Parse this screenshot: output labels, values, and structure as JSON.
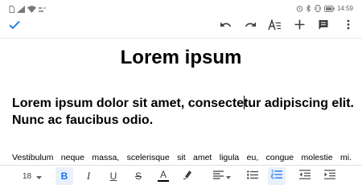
{
  "status_bar": {
    "time": "14:59",
    "left_icons": [
      "sim-icon",
      "signal-icon",
      "wifi-icon",
      "data-speed-icon"
    ],
    "right_icons": [
      "alarm-icon",
      "bluetooth-icon",
      "vibrate-icon",
      "battery-icon"
    ]
  },
  "toolbar": {
    "icons": [
      "check-icon",
      "undo-icon",
      "redo-icon",
      "text-format-icon",
      "add-icon",
      "comment-icon",
      "more-vert-icon"
    ],
    "accent_color": "#1a73e8"
  },
  "document": {
    "title": "Lorem ipsum",
    "heading_before_cursor": "Lorem ipsum dolor sit amet, consecte",
    "heading_after_cursor": "tur adipiscing elit. Nunc ac faucibus odio.",
    "body_line": "Vestibulum neque massa, scelerisque sit amet ligula eu, congue molestie mi."
  },
  "format_bar": {
    "font_size": "18",
    "bold": "B",
    "italic": "I",
    "underline": "U",
    "strikethrough": "S",
    "text_color": "A",
    "text_color_value": "#000000",
    "active_color": "#1a73e8",
    "active_bg": "#e8f0fe"
  }
}
